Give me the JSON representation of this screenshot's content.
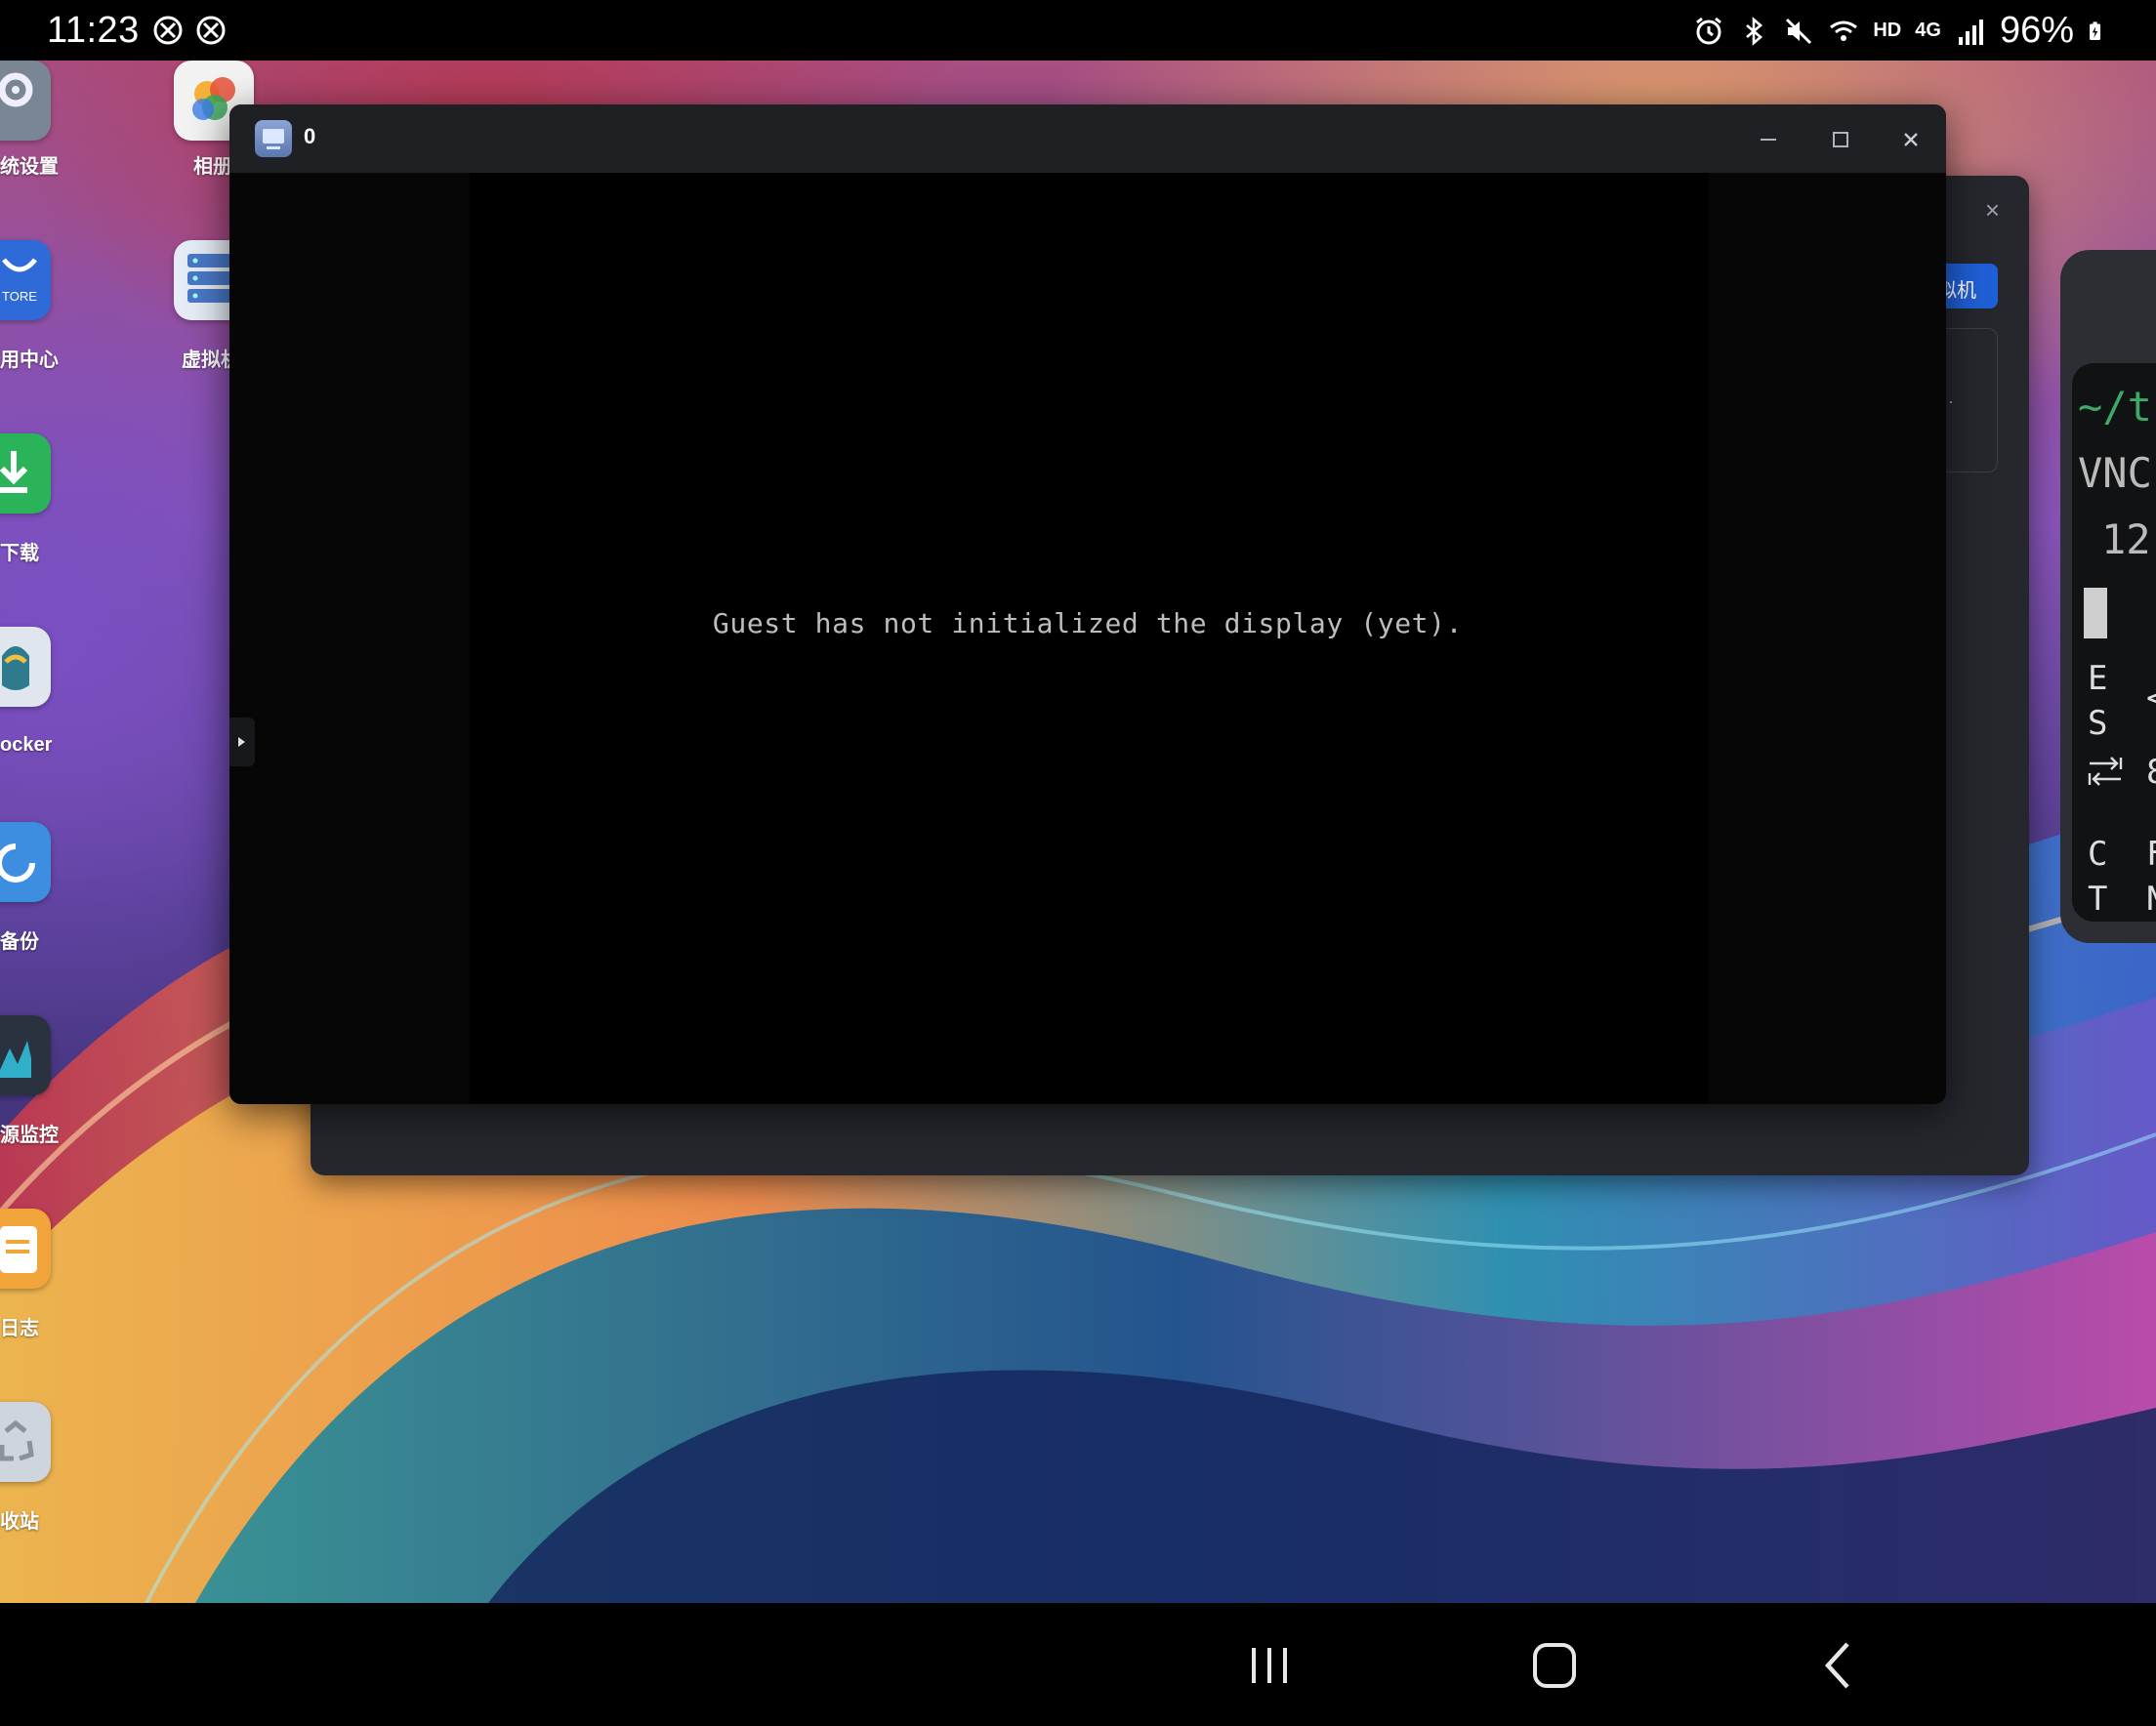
{
  "status_bar": {
    "time": "11:23",
    "network": "HD",
    "signal": "4G",
    "battery": "96%"
  },
  "desktop": {
    "apps": [
      {
        "label": "统设置",
        "icon": "gear-icon",
        "color": "#7b8694"
      },
      {
        "label": "相册",
        "icon": "photos-icon",
        "color": "#f2f2f2"
      },
      {
        "label": "用中心",
        "icon": "app-store-icon",
        "color": "#2f6bd8"
      },
      {
        "label": "虚拟机",
        "icon": "virtual-machine-icon",
        "color": "#e6ecf5"
      },
      {
        "label": "下载",
        "icon": "download-icon",
        "color": "#2bb35a"
      },
      {
        "label": "ocker",
        "icon": "docker-icon",
        "color": "#dfe6ee"
      },
      {
        "label": "备份",
        "icon": "backup-icon",
        "color": "#3d8de0"
      },
      {
        "label": "源监控",
        "icon": "resource-monitor-icon",
        "color": "#2a3240"
      },
      {
        "label": "日志",
        "icon": "log-icon",
        "color": "#f0a43a"
      },
      {
        "label": "收站",
        "icon": "recycle-bin-icon",
        "color": "#cfd5dc"
      }
    ]
  },
  "back_window": {
    "button_label": "拟机",
    "close": "×",
    "dot": "·"
  },
  "vm_window": {
    "title": "0",
    "message": "Guest has not initialized the display (yet)."
  },
  "terminal": {
    "line1": "~/t",
    "line2": "VNC",
    "line3": "12",
    "keys": {
      "esc_top": "E",
      "esc_bottom": "S",
      "esc_side": "<",
      "tab_side": "8",
      "ctrl_top": "C",
      "ctrl_bottom": "T",
      "fn_top": "F",
      "fn_bottom": "N"
    }
  },
  "colors": {
    "title_bar": "#1e2024",
    "vm_background": "#000000",
    "accent_button": "#1f5fd6",
    "terminal_prompt": "#3fa968"
  }
}
